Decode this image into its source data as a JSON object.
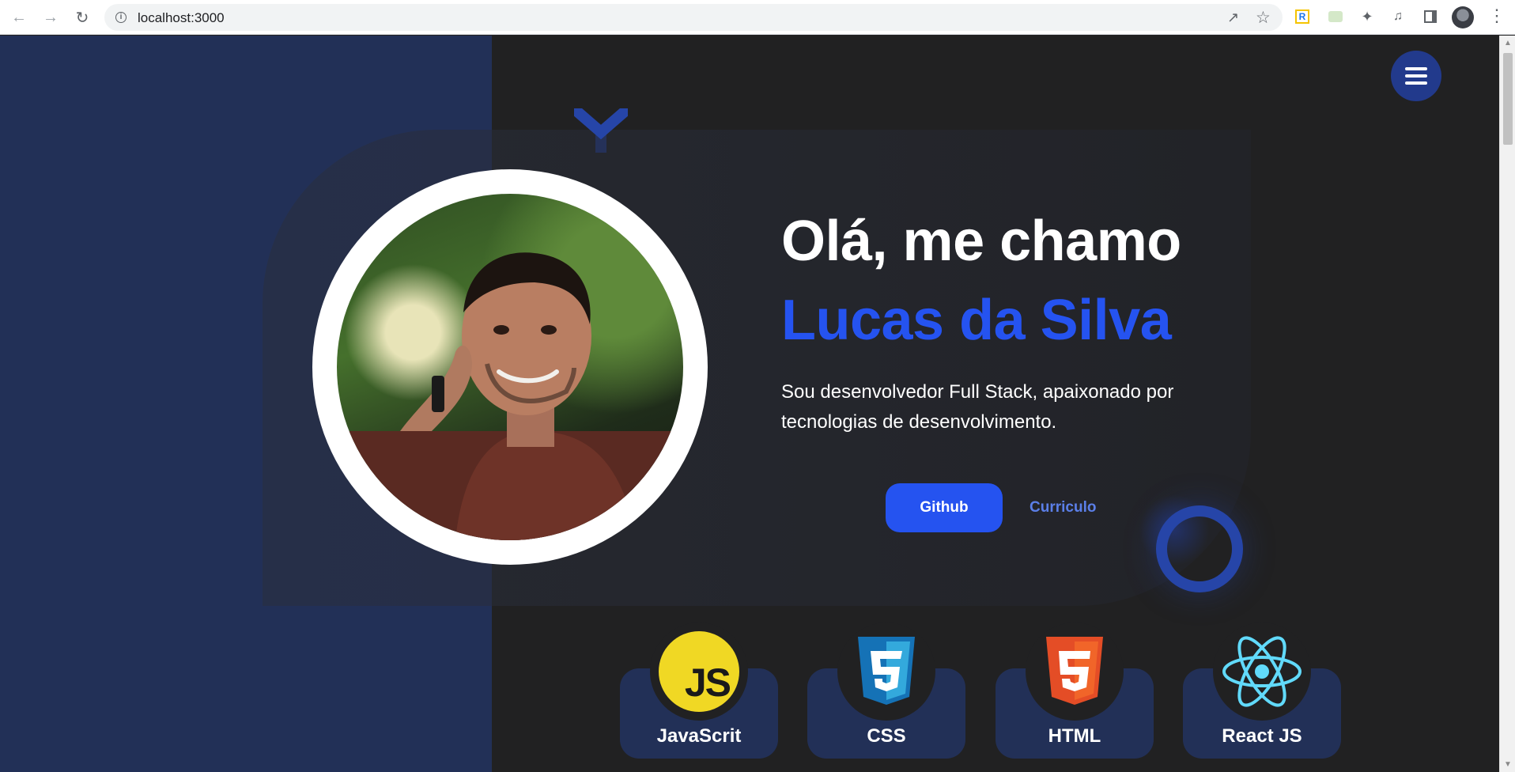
{
  "browser": {
    "url": "localhost:3000"
  },
  "hero": {
    "greeting": "Olá, me chamo",
    "name": "Lucas da Silva",
    "bio": "Sou desenvolvedor Full Stack, apaixonado por tecnologias de desenvolvimento.",
    "github_label": "Github",
    "curriculo_label": "Curriculo"
  },
  "skills": [
    {
      "label": "JavaScrit",
      "icon": "javascript-icon"
    },
    {
      "label": "CSS",
      "icon": "css3-icon"
    },
    {
      "label": "HTML",
      "icon": "html5-icon"
    },
    {
      "label": "React JS",
      "icon": "react-icon"
    }
  ],
  "colors": {
    "accent": "#2553f0",
    "navy_panel": "#223057",
    "background": "#212122",
    "menu_button": "#223a8c"
  }
}
